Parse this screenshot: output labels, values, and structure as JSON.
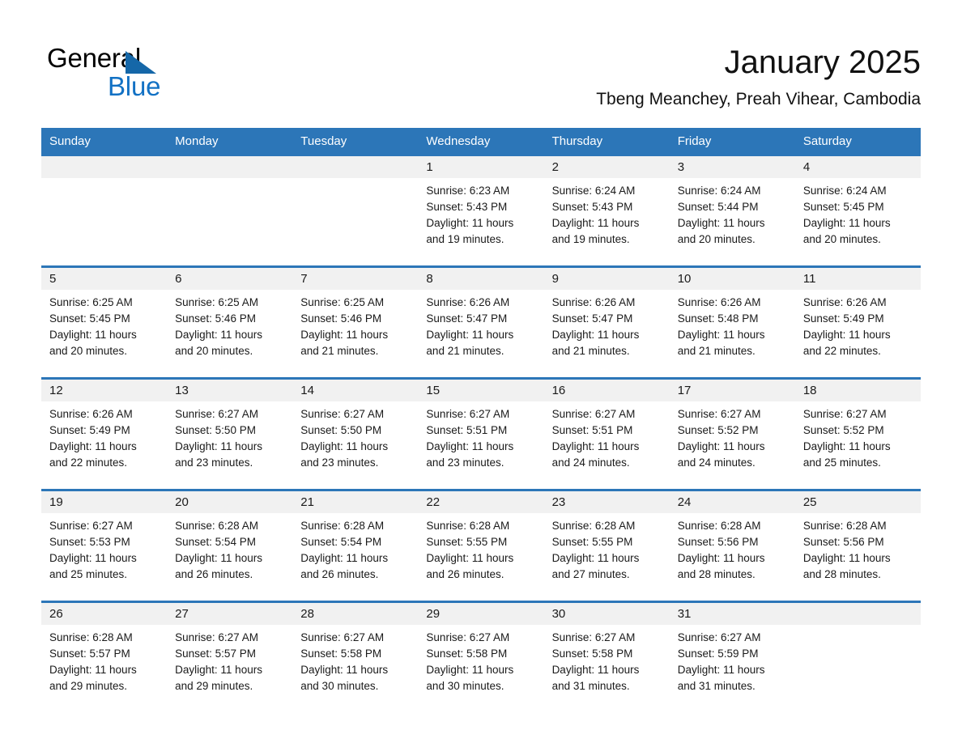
{
  "logo": {
    "word1": "General",
    "word2": "Blue",
    "triangle_color": "#1567a8",
    "blue_color": "#1271c4"
  },
  "header": {
    "title": "January 2025",
    "subtitle": "Tbeng Meanchey, Preah Vihear, Cambodia",
    "accent_color": "#2c76b8",
    "band_color": "#f1f1f1"
  },
  "calendar": {
    "weekday_headers": [
      "Sunday",
      "Monday",
      "Tuesday",
      "Wednesday",
      "Thursday",
      "Friday",
      "Saturday"
    ],
    "weeks": [
      [
        {
          "day": "",
          "empty": true
        },
        {
          "day": "",
          "empty": true
        },
        {
          "day": "",
          "empty": true
        },
        {
          "day": "1",
          "sunrise": "Sunrise: 6:23 AM",
          "sunset": "Sunset: 5:43 PM",
          "daylight_line1": "Daylight: 11 hours",
          "daylight_line2": "and 19 minutes."
        },
        {
          "day": "2",
          "sunrise": "Sunrise: 6:24 AM",
          "sunset": "Sunset: 5:43 PM",
          "daylight_line1": "Daylight: 11 hours",
          "daylight_line2": "and 19 minutes."
        },
        {
          "day": "3",
          "sunrise": "Sunrise: 6:24 AM",
          "sunset": "Sunset: 5:44 PM",
          "daylight_line1": "Daylight: 11 hours",
          "daylight_line2": "and 20 minutes."
        },
        {
          "day": "4",
          "sunrise": "Sunrise: 6:24 AM",
          "sunset": "Sunset: 5:45 PM",
          "daylight_line1": "Daylight: 11 hours",
          "daylight_line2": "and 20 minutes."
        }
      ],
      [
        {
          "day": "5",
          "sunrise": "Sunrise: 6:25 AM",
          "sunset": "Sunset: 5:45 PM",
          "daylight_line1": "Daylight: 11 hours",
          "daylight_line2": "and 20 minutes."
        },
        {
          "day": "6",
          "sunrise": "Sunrise: 6:25 AM",
          "sunset": "Sunset: 5:46 PM",
          "daylight_line1": "Daylight: 11 hours",
          "daylight_line2": "and 20 minutes."
        },
        {
          "day": "7",
          "sunrise": "Sunrise: 6:25 AM",
          "sunset": "Sunset: 5:46 PM",
          "daylight_line1": "Daylight: 11 hours",
          "daylight_line2": "and 21 minutes."
        },
        {
          "day": "8",
          "sunrise": "Sunrise: 6:26 AM",
          "sunset": "Sunset: 5:47 PM",
          "daylight_line1": "Daylight: 11 hours",
          "daylight_line2": "and 21 minutes."
        },
        {
          "day": "9",
          "sunrise": "Sunrise: 6:26 AM",
          "sunset": "Sunset: 5:47 PM",
          "daylight_line1": "Daylight: 11 hours",
          "daylight_line2": "and 21 minutes."
        },
        {
          "day": "10",
          "sunrise": "Sunrise: 6:26 AM",
          "sunset": "Sunset: 5:48 PM",
          "daylight_line1": "Daylight: 11 hours",
          "daylight_line2": "and 21 minutes."
        },
        {
          "day": "11",
          "sunrise": "Sunrise: 6:26 AM",
          "sunset": "Sunset: 5:49 PM",
          "daylight_line1": "Daylight: 11 hours",
          "daylight_line2": "and 22 minutes."
        }
      ],
      [
        {
          "day": "12",
          "sunrise": "Sunrise: 6:26 AM",
          "sunset": "Sunset: 5:49 PM",
          "daylight_line1": "Daylight: 11 hours",
          "daylight_line2": "and 22 minutes."
        },
        {
          "day": "13",
          "sunrise": "Sunrise: 6:27 AM",
          "sunset": "Sunset: 5:50 PM",
          "daylight_line1": "Daylight: 11 hours",
          "daylight_line2": "and 23 minutes."
        },
        {
          "day": "14",
          "sunrise": "Sunrise: 6:27 AM",
          "sunset": "Sunset: 5:50 PM",
          "daylight_line1": "Daylight: 11 hours",
          "daylight_line2": "and 23 minutes."
        },
        {
          "day": "15",
          "sunrise": "Sunrise: 6:27 AM",
          "sunset": "Sunset: 5:51 PM",
          "daylight_line1": "Daylight: 11 hours",
          "daylight_line2": "and 23 minutes."
        },
        {
          "day": "16",
          "sunrise": "Sunrise: 6:27 AM",
          "sunset": "Sunset: 5:51 PM",
          "daylight_line1": "Daylight: 11 hours",
          "daylight_line2": "and 24 minutes."
        },
        {
          "day": "17",
          "sunrise": "Sunrise: 6:27 AM",
          "sunset": "Sunset: 5:52 PM",
          "daylight_line1": "Daylight: 11 hours",
          "daylight_line2": "and 24 minutes."
        },
        {
          "day": "18",
          "sunrise": "Sunrise: 6:27 AM",
          "sunset": "Sunset: 5:52 PM",
          "daylight_line1": "Daylight: 11 hours",
          "daylight_line2": "and 25 minutes."
        }
      ],
      [
        {
          "day": "19",
          "sunrise": "Sunrise: 6:27 AM",
          "sunset": "Sunset: 5:53 PM",
          "daylight_line1": "Daylight: 11 hours",
          "daylight_line2": "and 25 minutes."
        },
        {
          "day": "20",
          "sunrise": "Sunrise: 6:28 AM",
          "sunset": "Sunset: 5:54 PM",
          "daylight_line1": "Daylight: 11 hours",
          "daylight_line2": "and 26 minutes."
        },
        {
          "day": "21",
          "sunrise": "Sunrise: 6:28 AM",
          "sunset": "Sunset: 5:54 PM",
          "daylight_line1": "Daylight: 11 hours",
          "daylight_line2": "and 26 minutes."
        },
        {
          "day": "22",
          "sunrise": "Sunrise: 6:28 AM",
          "sunset": "Sunset: 5:55 PM",
          "daylight_line1": "Daylight: 11 hours",
          "daylight_line2": "and 26 minutes."
        },
        {
          "day": "23",
          "sunrise": "Sunrise: 6:28 AM",
          "sunset": "Sunset: 5:55 PM",
          "daylight_line1": "Daylight: 11 hours",
          "daylight_line2": "and 27 minutes."
        },
        {
          "day": "24",
          "sunrise": "Sunrise: 6:28 AM",
          "sunset": "Sunset: 5:56 PM",
          "daylight_line1": "Daylight: 11 hours",
          "daylight_line2": "and 28 minutes."
        },
        {
          "day": "25",
          "sunrise": "Sunrise: 6:28 AM",
          "sunset": "Sunset: 5:56 PM",
          "daylight_line1": "Daylight: 11 hours",
          "daylight_line2": "and 28 minutes."
        }
      ],
      [
        {
          "day": "26",
          "sunrise": "Sunrise: 6:28 AM",
          "sunset": "Sunset: 5:57 PM",
          "daylight_line1": "Daylight: 11 hours",
          "daylight_line2": "and 29 minutes."
        },
        {
          "day": "27",
          "sunrise": "Sunrise: 6:27 AM",
          "sunset": "Sunset: 5:57 PM",
          "daylight_line1": "Daylight: 11 hours",
          "daylight_line2": "and 29 minutes."
        },
        {
          "day": "28",
          "sunrise": "Sunrise: 6:27 AM",
          "sunset": "Sunset: 5:58 PM",
          "daylight_line1": "Daylight: 11 hours",
          "daylight_line2": "and 30 minutes."
        },
        {
          "day": "29",
          "sunrise": "Sunrise: 6:27 AM",
          "sunset": "Sunset: 5:58 PM",
          "daylight_line1": "Daylight: 11 hours",
          "daylight_line2": "and 30 minutes."
        },
        {
          "day": "30",
          "sunrise": "Sunrise: 6:27 AM",
          "sunset": "Sunset: 5:58 PM",
          "daylight_line1": "Daylight: 11 hours",
          "daylight_line2": "and 31 minutes."
        },
        {
          "day": "31",
          "sunrise": "Sunrise: 6:27 AM",
          "sunset": "Sunset: 5:59 PM",
          "daylight_line1": "Daylight: 11 hours",
          "daylight_line2": "and 31 minutes."
        },
        {
          "day": "",
          "empty": true
        }
      ]
    ]
  }
}
